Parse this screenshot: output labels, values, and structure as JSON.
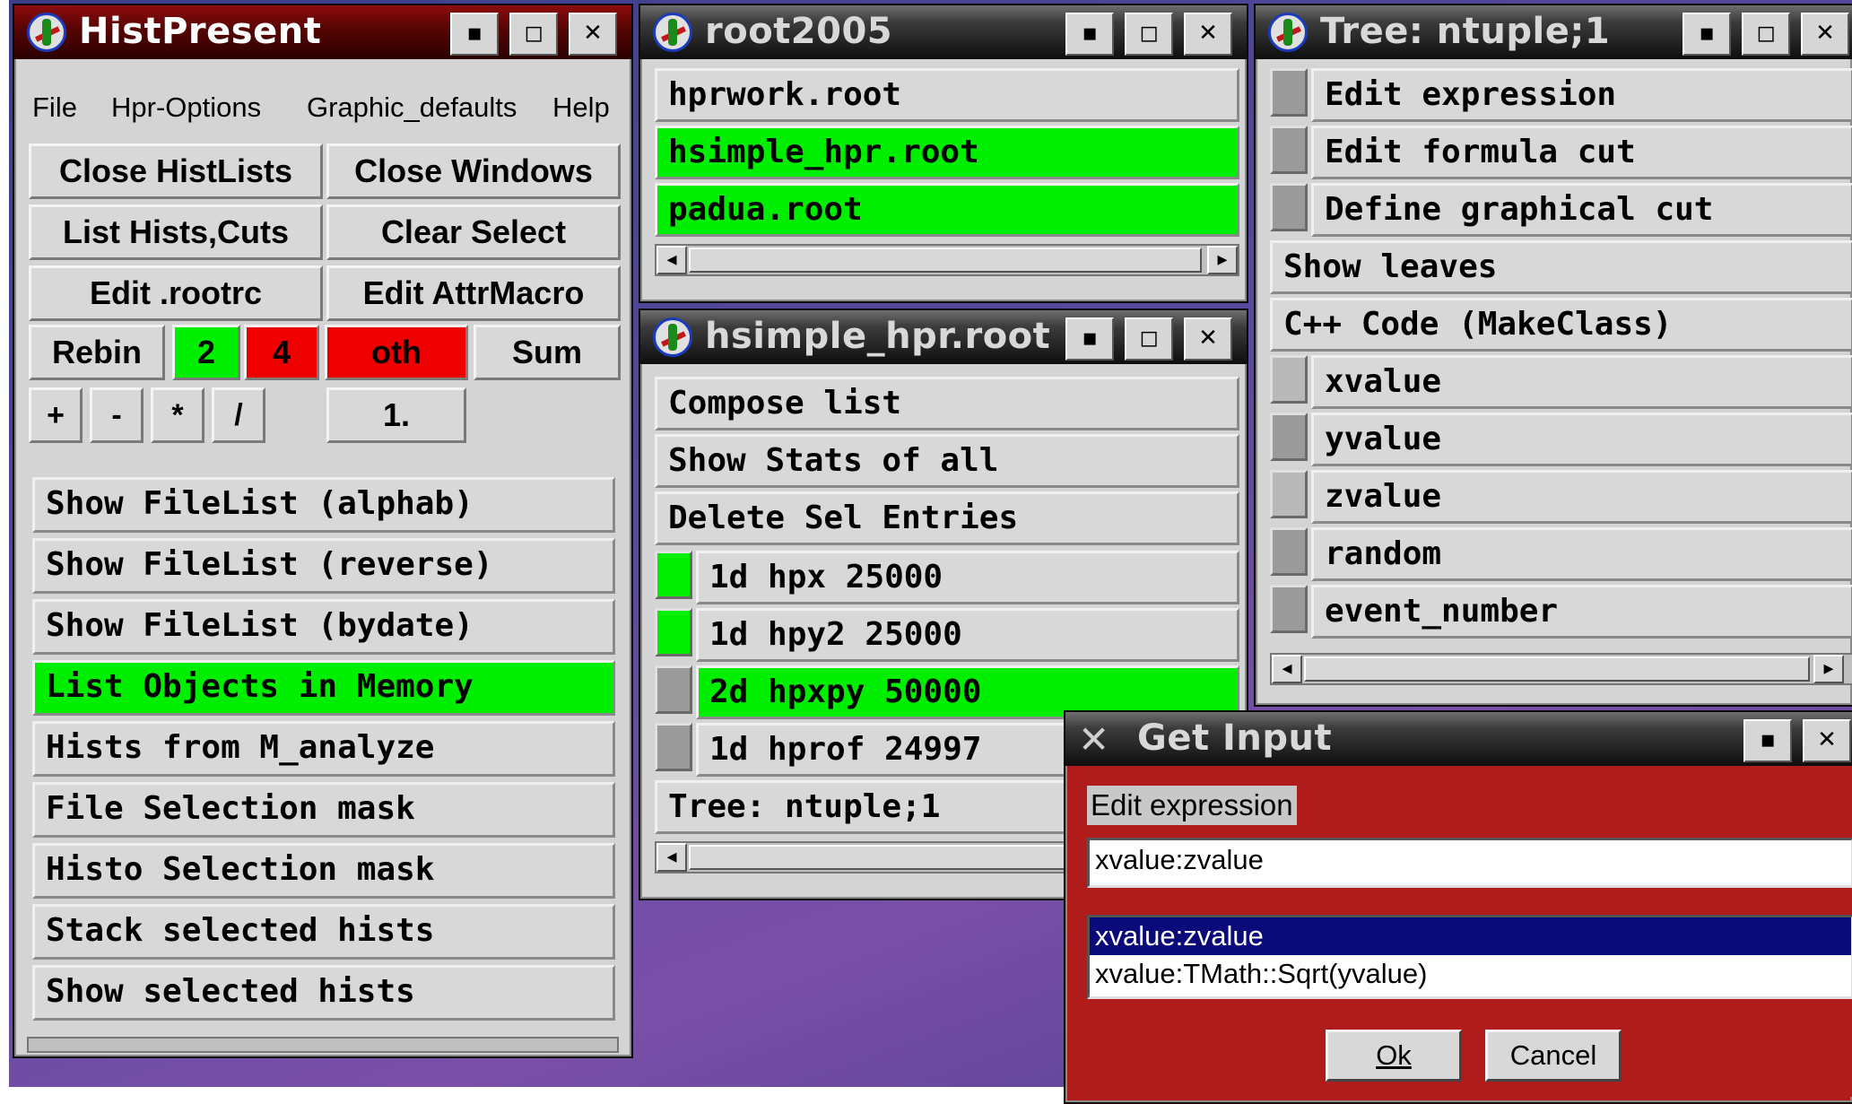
{
  "histpresent": {
    "title": "HistPresent",
    "menu": [
      "File",
      "Hpr-Options",
      "Graphic_defaults",
      "Help"
    ],
    "buttons": {
      "close_histlists": "Close HistLists",
      "close_windows": "Close Windows",
      "list_hists_cuts": "List Hists,Cuts",
      "clear_select": "Clear Select",
      "edit_rootrc": "Edit .rootrc",
      "edit_attrmacro": "Edit AttrMacro",
      "rebin": "Rebin",
      "rebin_2": "2",
      "rebin_4": "4",
      "rebin_oth": "oth",
      "sum": "Sum",
      "op_plus": "+",
      "op_minus": "-",
      "op_times": "*",
      "op_div": "/",
      "factor": "1."
    },
    "list": [
      "Show FileList (alphab)",
      "Show FileList (reverse)",
      "Show FileList (bydate)",
      "List Objects in Memory",
      "Hists from M_analyze",
      "File Selection mask",
      "Histo Selection mask",
      "Stack selected hists",
      "Show selected hists"
    ]
  },
  "root2005": {
    "title": "root2005",
    "files": [
      "hprwork.root",
      "hsimple_hpr.root",
      "padua.root"
    ]
  },
  "hsimple": {
    "title": "hsimple_hpr.root",
    "actions": [
      "Compose list",
      "Show Stats of all",
      "Delete Sel Entries"
    ],
    "entries": [
      "1d hpx 25000",
      "1d hpy2 25000",
      "2d hpxpy 50000",
      "1d hprof 24997"
    ],
    "tree": "Tree: ntuple;1"
  },
  "tree": {
    "title": "Tree: ntuple;1",
    "items": [
      "Edit expression",
      "Edit formula cut",
      "Define graphical cut",
      "Show leaves",
      "C++ Code (MakeClass)",
      "xvalue",
      "yvalue",
      "zvalue",
      "random",
      "event_number"
    ]
  },
  "get_input": {
    "title": "Get Input",
    "label": "Edit expression",
    "value": "xvalue:zvalue",
    "options": [
      "xvalue:zvalue",
      "xvalue:TMath::Sqrt(yvalue)"
    ],
    "ok": "Ok",
    "cancel": "Cancel"
  },
  "window_buttons": {
    "minimize": "▪",
    "maximize": "◻",
    "close": "✕"
  },
  "colors": {
    "selected_green": "#00ee00",
    "alert_red": "#ee0000",
    "dialog_red": "#b01c1c",
    "list_select": "#0a0a7a"
  }
}
